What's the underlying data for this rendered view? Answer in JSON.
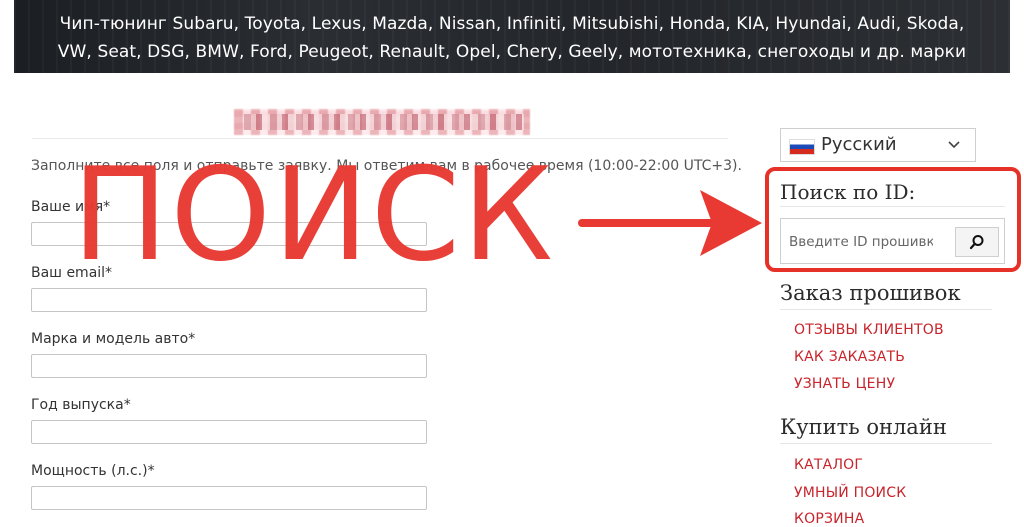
{
  "banner": {
    "line1": "Чип-тюнинг Subaru, Toyota, Lexus, Mazda, Nissan, Infiniti, Mitsubishi, Honda, KIA, Hyundai, Audi, Skoda,",
    "line2": "VW, Seat, DSG, BMW,  Ford, Peugeot, Renault, Opel, Chery, Geely,  мототехника, снегоходы и др. марки"
  },
  "overlay": {
    "big_text": "ПОИСК",
    "color": "#e83a32"
  },
  "form": {
    "intro": "Заполните все поля и отправьте заявку. Мы ответим вам в рабочее время (10:00-22:00 UTC+3).",
    "fields": [
      {
        "label": "Ваше имя*"
      },
      {
        "label": "Ваш email*"
      },
      {
        "label": "Марка и модель авто*"
      },
      {
        "label": "Год выпуска*"
      },
      {
        "label": "Мощность (л.с.)*"
      }
    ]
  },
  "sidebar": {
    "language": {
      "selected": "Русский",
      "flag_icon": "flag-ru-icon"
    },
    "search_widget": {
      "title": "Поиск по ID:",
      "placeholder": "Введите ID прошивки",
      "button_icon": "search-icon"
    },
    "orders_widget": {
      "title": "Заказ прошивок",
      "links": [
        "ОТЗЫВЫ КЛИЕНТОВ",
        "КАК ЗАКАЗАТЬ",
        "УЗНАТЬ ЦЕНУ"
      ]
    },
    "buy_widget": {
      "title": "Купить онлайн",
      "links": [
        "КАТАЛОГ",
        "УМНЫЙ ПОИСК",
        "КОРЗИНА"
      ]
    }
  },
  "colors": {
    "accent_red": "#e63129",
    "link_red": "#c8242b"
  }
}
